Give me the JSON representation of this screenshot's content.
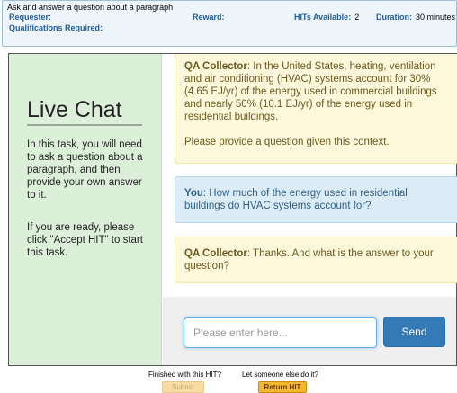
{
  "hit": {
    "title": "Ask and answer a question about a paragraph",
    "requester_label": "Requester:",
    "reward_label": "Reward:",
    "hits_available_label": "HITs Available:",
    "hits_available_value": "2",
    "duration_label": "Duration:",
    "duration_value": "30 minutes",
    "qualifications_label": "Qualifications Required:"
  },
  "sidebar": {
    "heading": "Live Chat",
    "paragraph1": "In this task, you will need to ask a question about a paragraph, and then provide your own answer to it.",
    "paragraph2": "If you are ready, please click \"Accept HIT\" to start this task."
  },
  "messages": [
    {
      "speaker": "QA Collector",
      "text": ": In the United States, heating, ventilation and air conditioning (HVAC) systems account for 30% (4.65 EJ/yr) of the energy used in commercial buildings and nearly 50% (10.1 EJ/yr) of the energy used in residential buildings.",
      "text2": "Please provide a question given this context."
    },
    {
      "speaker": "You",
      "text": ": How much of the energy used in residential buildings do HVAC systems account for?"
    },
    {
      "speaker": "QA Collector",
      "text": ": Thanks. And what is the answer to your question?"
    }
  ],
  "input": {
    "placeholder": "Please enter here...",
    "send_label": "Send"
  },
  "footer": {
    "finished_text": "Finished with this HIT?",
    "someone_else_text": "Let someone else do it?",
    "submit_label": "Submit HIT",
    "return_label": "Return HIT"
  }
}
